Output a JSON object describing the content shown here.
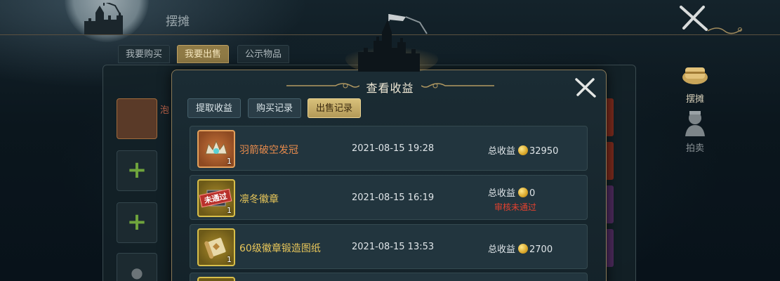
{
  "header": {
    "title": "摆摊"
  },
  "back_tabs": [
    "我要购买",
    "我要出售",
    "公示物品"
  ],
  "back_panel": {
    "partial_text": "泡"
  },
  "side_menu": [
    {
      "label": "摆摊",
      "icon": "treasure-chest-icon",
      "active": true
    },
    {
      "label": "拍卖",
      "icon": "auctioneer-icon",
      "active": false
    }
  ],
  "modal": {
    "title": "查看收益",
    "tabs": [
      {
        "label": "提取收益",
        "active": false
      },
      {
        "label": "购买记录",
        "active": false
      },
      {
        "label": "出售记录",
        "active": true
      }
    ],
    "rows": [
      {
        "name": "羽箭破空发冠",
        "quantity": "1",
        "time": "2021-08-15  19:28",
        "income_label": "总收益",
        "income": "32950",
        "status": "",
        "icon": "crown-icon",
        "rarity_color": "#e3a05c"
      },
      {
        "name": "凛冬徽章",
        "quantity": "1",
        "time": "2021-08-15  16:19",
        "income_label": "总收益",
        "income": "0",
        "status": "审核未通过",
        "stamp": "未通过",
        "icon": "badge-icon",
        "rarity_color": "#d8bf4a"
      },
      {
        "name": "60级徽章锻造图纸",
        "quantity": "1",
        "time": "2021-08-15  13:53",
        "income_label": "总收益",
        "income": "2700",
        "status": "",
        "icon": "scroll-icon",
        "rarity_color": "#d8bf4a"
      }
    ]
  }
}
